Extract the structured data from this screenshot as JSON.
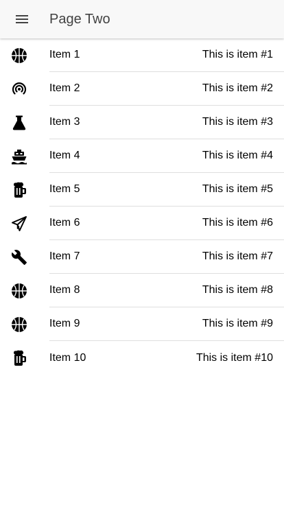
{
  "header": {
    "title": "Page Two",
    "menu_icon": "menu-icon"
  },
  "items": [
    {
      "label": "Item 1",
      "note": "This is item #1",
      "icon": "basketball-icon"
    },
    {
      "label": "Item 2",
      "note": "This is item #2",
      "icon": "wifi-icon"
    },
    {
      "label": "Item 3",
      "note": "This is item #3",
      "icon": "flask-icon"
    },
    {
      "label": "Item 4",
      "note": "This is item #4",
      "icon": "boat-icon"
    },
    {
      "label": "Item 5",
      "note": "This is item #5",
      "icon": "beer-icon"
    },
    {
      "label": "Item 6",
      "note": "This is item #6",
      "icon": "paper-plane-icon"
    },
    {
      "label": "Item 7",
      "note": "This is item #7",
      "icon": "wrench-icon"
    },
    {
      "label": "Item 8",
      "note": "This is item #8",
      "icon": "basketball-icon"
    },
    {
      "label": "Item 9",
      "note": "This is item #9",
      "icon": "basketball-icon"
    },
    {
      "label": "Item 10",
      "note": "This is item #10",
      "icon": "beer-icon"
    }
  ]
}
